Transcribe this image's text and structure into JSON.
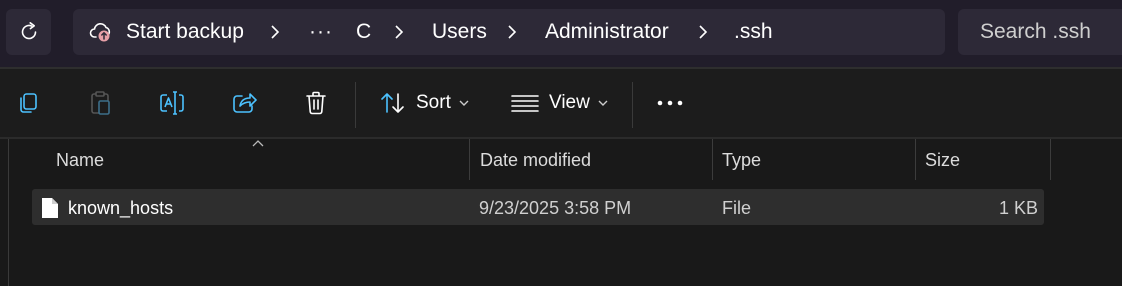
{
  "nav": {
    "refresh_icon": "refresh-icon"
  },
  "address": {
    "backup_icon": "cloud-upload-icon",
    "backup_label": "Start backup",
    "overflow_label": "···",
    "crumbs": [
      "C",
      "Users",
      "Administrator",
      ".ssh"
    ]
  },
  "search": {
    "placeholder": "Search .ssh"
  },
  "toolbar": {
    "copy_icon": "copy-icon",
    "paste_icon": "paste-icon",
    "rename_icon": "rename-icon",
    "share_icon": "share-icon",
    "delete_icon": "trash-icon",
    "sort_label": "Sort",
    "view_label": "View",
    "more_icon": "more-horizontal-icon"
  },
  "columns": [
    "Name",
    "Date modified",
    "Type",
    "Size"
  ],
  "files": [
    {
      "icon": "file-icon",
      "name": "known_hosts",
      "date_modified": "9/23/2025 3:58 PM",
      "type": "File",
      "size": "1 KB"
    }
  ],
  "colors": {
    "titlebar": "#211d2a",
    "field": "#2d2937",
    "toolbar": "#1c1c1c",
    "content": "#191919",
    "selected_row": "#2e2e2e",
    "text": "#ffffff"
  }
}
